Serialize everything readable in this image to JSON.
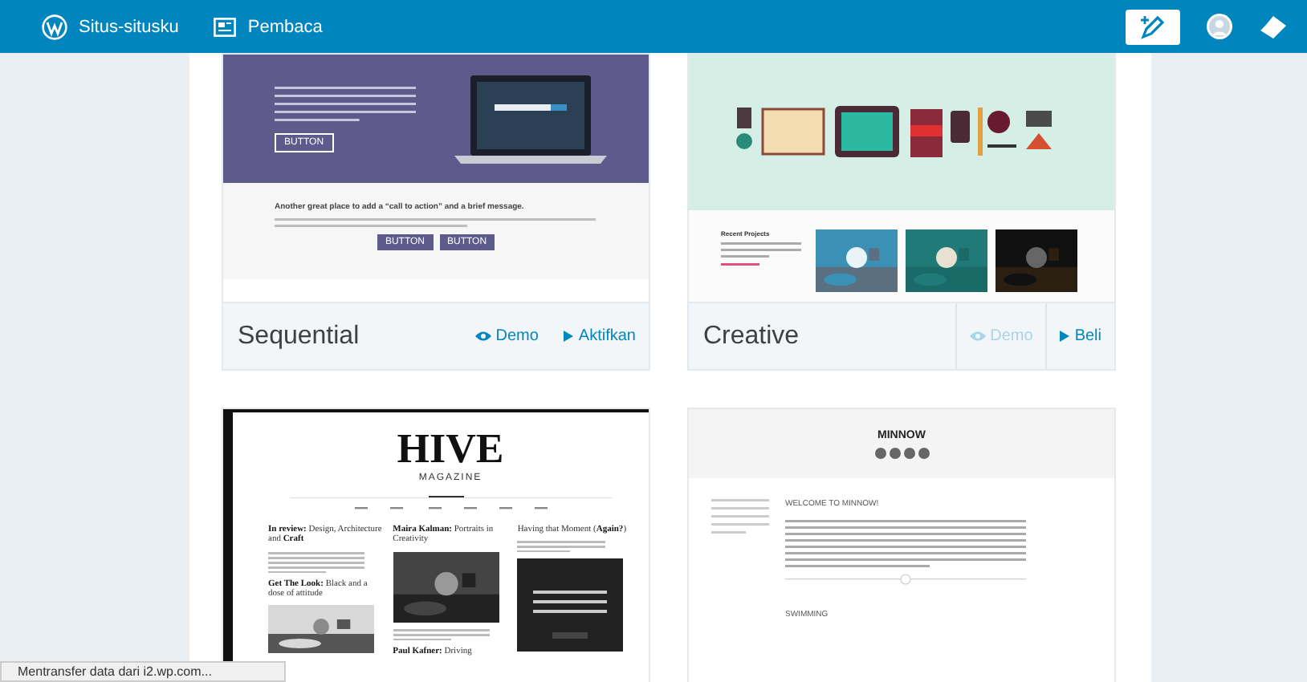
{
  "topbar": {
    "items": [
      {
        "kind": "sites",
        "label": "Situs-situsku"
      },
      {
        "kind": "reader",
        "label": "Pembaca"
      }
    ]
  },
  "themes": [
    {
      "name": "Sequential",
      "preview": {
        "kind": "sequential",
        "buttons": [
          "BUTTON",
          "BUTTON",
          "BUTTON"
        ],
        "headline": "Another great place to add a “call to action” and a brief message."
      },
      "actions": [
        {
          "kind": "demo",
          "label": "Demo",
          "dimmed": false
        },
        {
          "kind": "activate",
          "label": "Aktifkan",
          "dimmed": false
        }
      ]
    },
    {
      "name": "Creative",
      "preview": {
        "kind": "creative",
        "headline": "Recent Projects"
      },
      "actions": [
        {
          "kind": "demo",
          "label": "Demo",
          "dimmed": true
        },
        {
          "kind": "buy",
          "label": "Beli",
          "dimmed": false
        }
      ]
    },
    {
      "preview": {
        "kind": "hive",
        "logo": "HIVE",
        "tagline": "MAGAZINE",
        "headlines": [
          "**In review:** Design, Architecture and **Craft**",
          "**Maira Kalman:** Portraits in Creativity",
          "Having that Moment (**Again?**)",
          "**Get The Look:** Black and a dose of attitude",
          "**Paul Kafner:** Driving"
        ]
      }
    },
    {
      "preview": {
        "kind": "minnow",
        "logo": "MINNOW",
        "headlines": [
          "WELCOME TO MINNOW!",
          "SWIMMING"
        ]
      }
    }
  ],
  "status_bar": {
    "text": "Mentransfer data dari i2.wp.com..."
  }
}
